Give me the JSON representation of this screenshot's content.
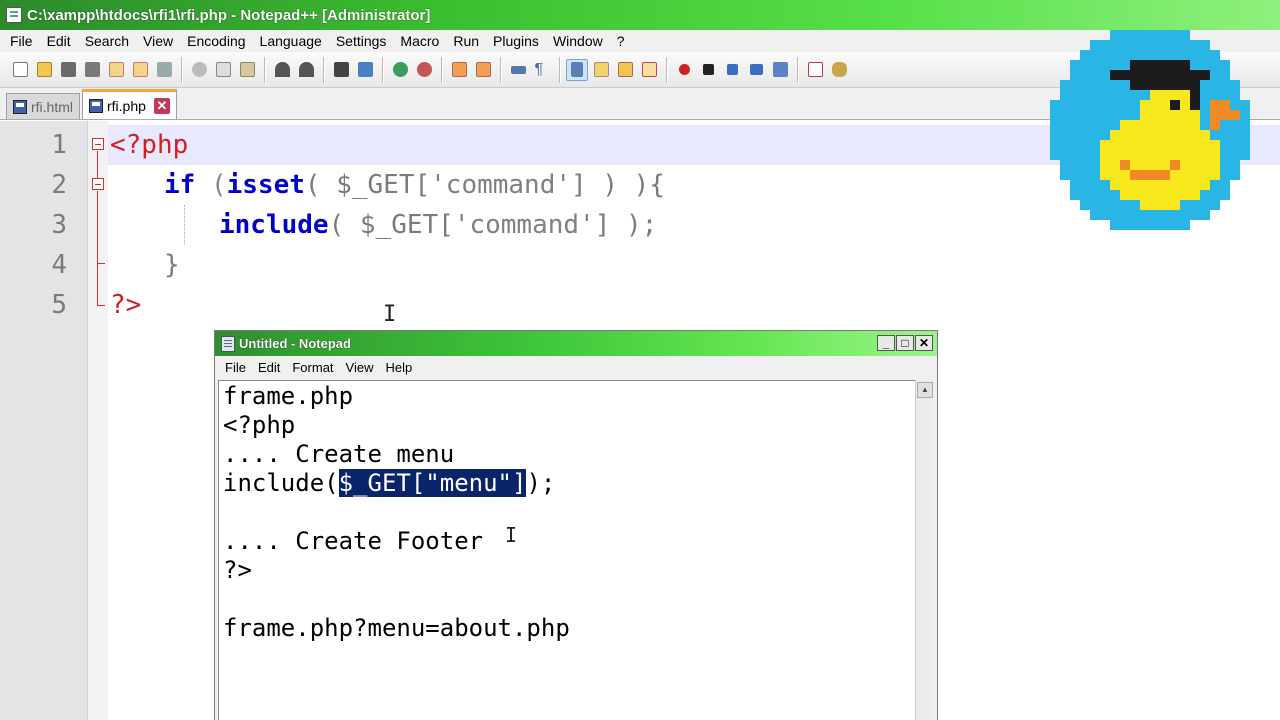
{
  "npp": {
    "title": "C:\\xampp\\htdocs\\rfi1\\rfi.php - Notepad++ [Administrator]",
    "menu": [
      "File",
      "Edit",
      "Search",
      "View",
      "Encoding",
      "Language",
      "Settings",
      "Macro",
      "Run",
      "Plugins",
      "Window",
      "?"
    ],
    "tabs": [
      {
        "label": "rfi.html",
        "state": "inactive"
      },
      {
        "label": "rfi.php",
        "state": "active",
        "close": "✕"
      }
    ],
    "line_numbers": [
      "1",
      "2",
      "3",
      "4",
      "5"
    ],
    "code": {
      "l1_open": "<?php",
      "l2_if": "if",
      "l2_paren_open": " (",
      "l2_isset": "isset",
      "l2_rest_a": "( $_GET[",
      "l2_str": "'command'",
      "l2_rest_b": "] ) ){",
      "l3_include": "include",
      "l3_rest_a": "( $_GET[",
      "l3_str": "'command'",
      "l3_rest_b": "] );",
      "l4_brace": "}",
      "l5_close": "?>"
    },
    "colors": {
      "keyword": "#0000cc",
      "php_tag": "#d02020",
      "string": "#808080",
      "current_line": "#e8e8ff"
    }
  },
  "notepad": {
    "title": "Untitled - Notepad",
    "menu": [
      "File",
      "Edit",
      "Format",
      "View",
      "Help"
    ],
    "window_buttons": [
      "_",
      "□",
      "✕"
    ],
    "lines": {
      "l1": "frame.php",
      "l2": "<?php",
      "l3": ".... Create menu",
      "l4_before": "include(",
      "l4_selected": "$_GET[\"menu\"]",
      "l4_after": ");",
      "l5": "",
      "l6": ".... Create Footer",
      "l7": "?>",
      "l8": "",
      "l9": "frame.php?menu=about.php"
    }
  },
  "logo": {
    "icon": "duck-graduation-cap-icon",
    "bg_color": "#29b6e6",
    "duck_color": "#f7e81c"
  }
}
